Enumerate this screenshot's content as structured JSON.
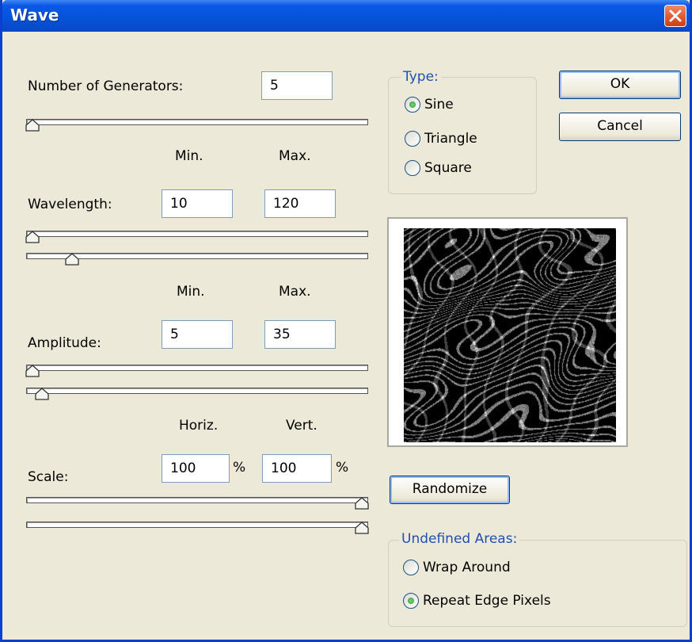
{
  "window": {
    "title": "Wave"
  },
  "generators": {
    "label": "Number of Generators:",
    "value": "5",
    "slider_fraction": 0.0
  },
  "columns": {
    "min": "Min.",
    "max": "Max.",
    "horiz": "Horiz.",
    "vert": "Vert."
  },
  "wavelength": {
    "label": "Wavelength:",
    "min": "10",
    "max": "120",
    "min_slider": 0.0,
    "max_slider": 0.12
  },
  "amplitude": {
    "label": "Amplitude:",
    "min": "5",
    "max": "35",
    "min_slider": 0.0,
    "max_slider": 0.03
  },
  "scale": {
    "label": "Scale:",
    "horiz": "100",
    "vert": "100",
    "unit": "%",
    "horiz_slider": 1.0,
    "vert_slider": 1.0
  },
  "type": {
    "label": "Type:",
    "options": [
      "Sine",
      "Triangle",
      "Square"
    ],
    "selected": "Sine"
  },
  "buttons": {
    "ok": "OK",
    "cancel": "Cancel",
    "randomize": "Randomize"
  },
  "undefined_areas": {
    "label": "Undefined Areas:",
    "options": [
      "Wrap Around",
      "Repeat Edge Pixels"
    ],
    "selected": "Repeat Edge Pixels"
  },
  "colors": {
    "title_bar": "#0653d9",
    "group_label": "#1f4fb3",
    "radio_dot": "#2a9d2a",
    "close": "#e35d35"
  }
}
